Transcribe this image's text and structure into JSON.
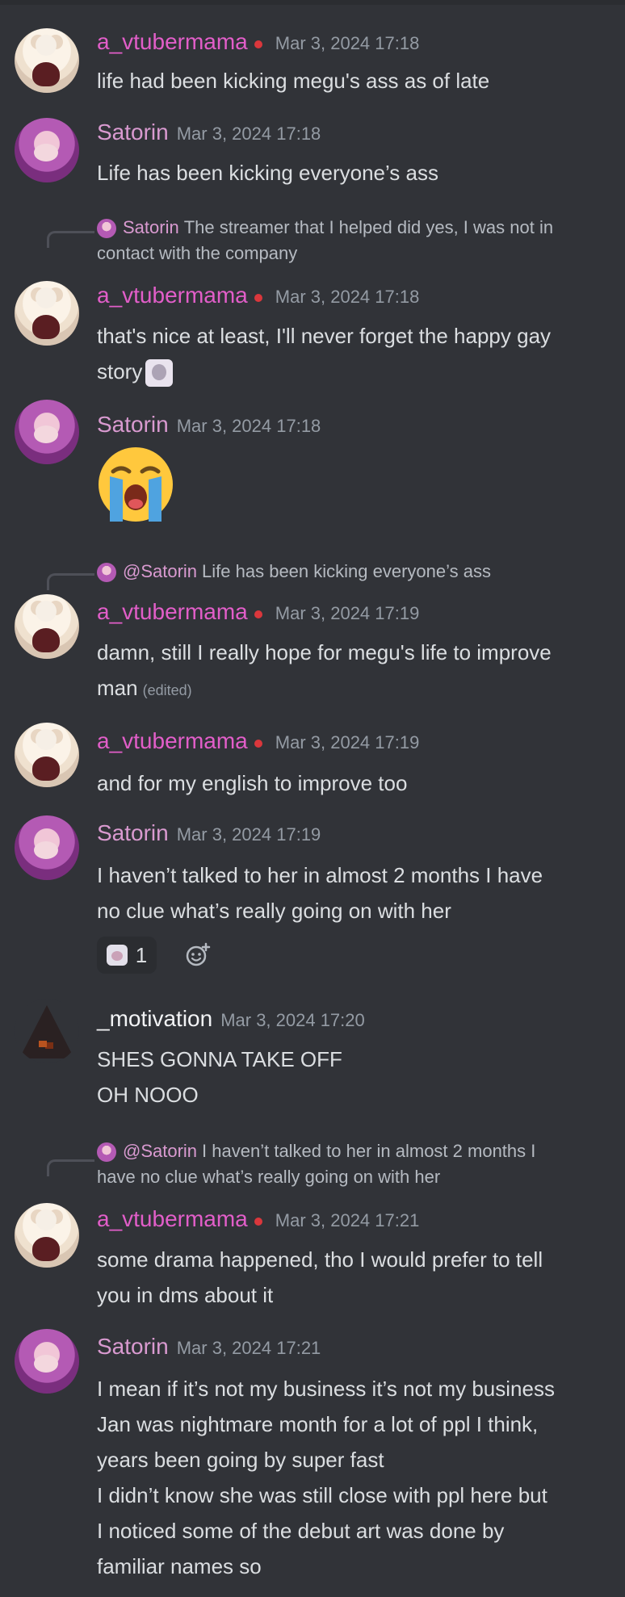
{
  "messages": [
    {
      "author": "a_vtubermama",
      "timestamp": "Mar 3, 2024 17:18",
      "lines": [
        "life had been kicking megu's ass as of late"
      ]
    },
    {
      "author": "Satorin",
      "timestamp": "Mar 3, 2024 17:18",
      "lines": [
        "Life has been kicking everyone’s ass"
      ]
    },
    {
      "reply": {
        "author": "Satorin",
        "lines": [
          "The streamer that I helped did yes, I was not in",
          "contact with the company"
        ]
      },
      "author": "a_vtubermama",
      "timestamp": "Mar 3, 2024 17:18",
      "lines": [
        "that's nice at least, I'll never forget the happy gay",
        "story"
      ]
    },
    {
      "author": "Satorin",
      "timestamp": "Mar 3, 2024 17:18",
      "emoji": "loudly-crying-face"
    },
    {
      "reply": {
        "author": "@Satorin",
        "lines": [
          "Life has been kicking everyone’s ass"
        ]
      },
      "author": "a_vtubermama",
      "timestamp": "Mar 3, 2024 17:19",
      "lines": [
        "damn, still I really hope for megu's life to improve",
        "man"
      ],
      "edited": "(edited)"
    },
    {
      "author": "a_vtubermama",
      "timestamp": "Mar 3, 2024 17:19",
      "lines": [
        "and for my english to improve too"
      ]
    },
    {
      "author": "Satorin",
      "timestamp": "Mar 3, 2024 17:19",
      "lines": [
        "I haven’t talked to her in almost 2 months I have",
        "no clue what’s really going on with her"
      ],
      "reaction_count": "1"
    },
    {
      "author": "_motivation",
      "timestamp": "Mar 3, 2024 17:20",
      "lines": [
        "SHES GONNA TAKE OFF",
        "OH NOOO"
      ]
    },
    {
      "reply": {
        "author": "@Satorin",
        "lines": [
          "I haven’t talked to her in almost 2 months I",
          "have no clue what’s really going on with her"
        ]
      },
      "author": "a_vtubermama",
      "timestamp": "Mar 3, 2024 17:21",
      "lines": [
        "some drama happened, tho I would prefer to tell",
        "you in dms about it"
      ]
    },
    {
      "author": "Satorin",
      "timestamp": "Mar 3, 2024 17:21",
      "lines": [
        "I mean if it’s not my business it’s not my business",
        "Jan was nightmare month for a lot of ppl I think,",
        "years been going by super fast",
        "I didn’t know she was still close with ppl here but",
        "I noticed some of the debut art was done by",
        "familiar names so"
      ]
    }
  ]
}
